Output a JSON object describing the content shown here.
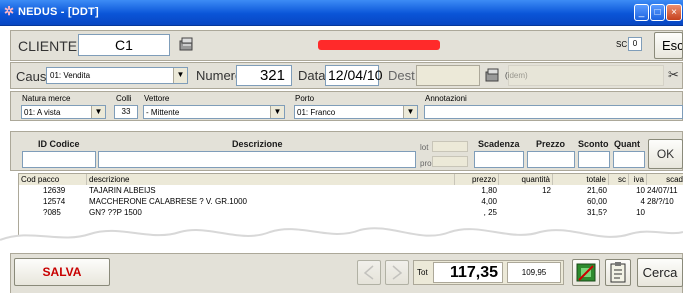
{
  "window": {
    "title": "NEDUS - [DDT]"
  },
  "header": {
    "cliente_label": "CLIENTE",
    "cliente_value": "C1",
    "sc_label": "SC",
    "sc_value": "0",
    "esci_label": "Esci"
  },
  "row2": {
    "caus_label": "Caus",
    "caus_value": "01: Vendita",
    "numero_label": "Numero",
    "numero_value": "321",
    "data_label": "Data",
    "data_value": "12/04/10",
    "dest_label": "Dest",
    "idem_label": "(idem)"
  },
  "row3": {
    "natura_label": "Natura merce",
    "natura_value": "01: A vista",
    "colli_label": "Colli",
    "colli_value": "33",
    "vettore_label": "Vettore",
    "vettore_value": "- Mittente",
    "porto_label": "Porto",
    "porto_value": "01: Franco",
    "annotazioni_label": "Annotazioni"
  },
  "entry": {
    "id_codice_label": "ID Codice",
    "descrizione_label": "Descrizione",
    "lot_label": "lot",
    "pro_label": "pro",
    "scadenza_label": "Scadenza",
    "prezzo_label": "Prezzo",
    "sconto_label": "Sconto",
    "quant_label": "Quant",
    "ok_label": "OK"
  },
  "table": {
    "headers": [
      "Cod pacco",
      "descrizione",
      "prezzo",
      "quantità",
      "totale",
      "sc",
      "iva",
      "scad"
    ],
    "rows": [
      [
        "12639",
        "TAJARIN ALBEIJS",
        "1,80",
        "12",
        "21,60",
        "",
        "10",
        "24/07/11"
      ],
      [
        "12574",
        "MACCHERONE CALABRESE ? V. GR.1000",
        "4,00",
        "",
        "60,00",
        "",
        "4",
        "28/?/10"
      ],
      [
        "?085",
        "GN? ??P 1500",
        ", 25",
        "",
        "31,5?",
        "",
        "10",
        ""
      ]
    ]
  },
  "footer": {
    "salva_label": "SALVA",
    "tot_label": "Tot",
    "tot_value": "117,35",
    "sub_value": "109,95",
    "cerca_label": "Cerca"
  },
  "colors": {
    "titlebar": "#0a55d8",
    "redact": "#ff2a2a",
    "salva_text": "#c80000",
    "ok_green": "#2e8b2e"
  }
}
